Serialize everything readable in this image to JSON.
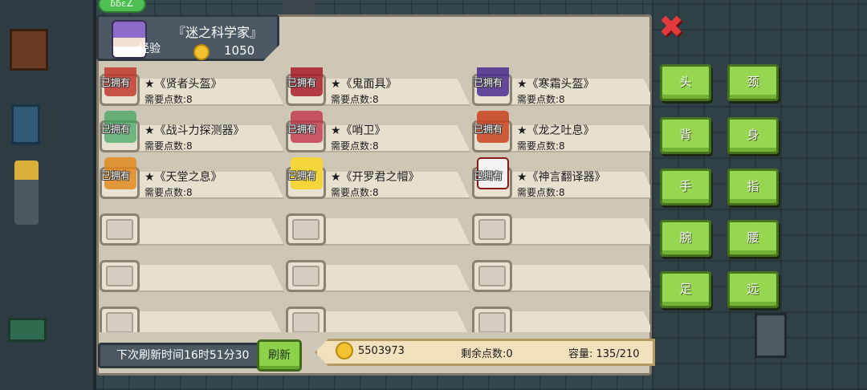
{
  "profile": {
    "name": "『迷之科学家』",
    "coins": "1050",
    "exp_label": "经验",
    "badge": "ɓɓɛ∠"
  },
  "items": [
    {
      "name": "★《贤者头盔》",
      "cost": "需要点数:8",
      "owned": "已拥有",
      "icon": "sage-helmet-icon",
      "color": "#c0392b"
    },
    {
      "name": "★《鬼面具》",
      "cost": "需要点数:8",
      "owned": "已拥有",
      "icon": "ghost-mask-icon",
      "color": "#a81d2a"
    },
    {
      "name": "★《寒霜头盔》",
      "cost": "需要点数:8",
      "owned": "已拥有",
      "icon": "frost-helmet-icon",
      "color": "#4b2d8f"
    },
    {
      "name": "★《战斗力探测器》",
      "cost": "需要点数:8",
      "owned": "已拥有",
      "icon": "scouter-icon",
      "color": "#3aa35b"
    },
    {
      "name": "★《哨卫》",
      "cost": "需要点数:8",
      "owned": "已拥有",
      "icon": "sentinel-helmet-icon",
      "color": "#c2354a"
    },
    {
      "name": "★《龙之吐息》",
      "cost": "需要点数:8",
      "owned": "已拥有",
      "icon": "dragon-breath-icon",
      "color": "#c9431f"
    },
    {
      "name": "★《天堂之息》",
      "cost": "需要点数:8",
      "owned": "已拥有",
      "icon": "heaven-breath-icon",
      "color": "#e08a1e"
    },
    {
      "name": "★《开罗君之帽》",
      "cost": "需要点数:8",
      "owned": "已拥有",
      "icon": "kairo-hat-icon",
      "color": "#f4d63a"
    },
    {
      "name": "★《神言翻译器》",
      "cost": "需要点数:8",
      "owned": "已拥有",
      "icon": "translator-icon",
      "color": "#f2f2f2"
    }
  ],
  "refresh": {
    "timer_text": "下次刷新时间16时51分30",
    "button_label": "刷新"
  },
  "stats": {
    "coins": "5503973",
    "points_left": "剩余点数:0",
    "capacity": "容量: 135/210"
  },
  "close_icon": "✖",
  "slots": {
    "head": "头",
    "neck": "颈",
    "back": "背",
    "body": "身",
    "hand": "手",
    "finger": "指",
    "wrist": "腕",
    "waist": "腰",
    "foot": "足",
    "ranged": "远"
  },
  "colors": {
    "panel": "#cfc7b6",
    "slot_button": "#96d651",
    "close": "#e23b3b"
  }
}
